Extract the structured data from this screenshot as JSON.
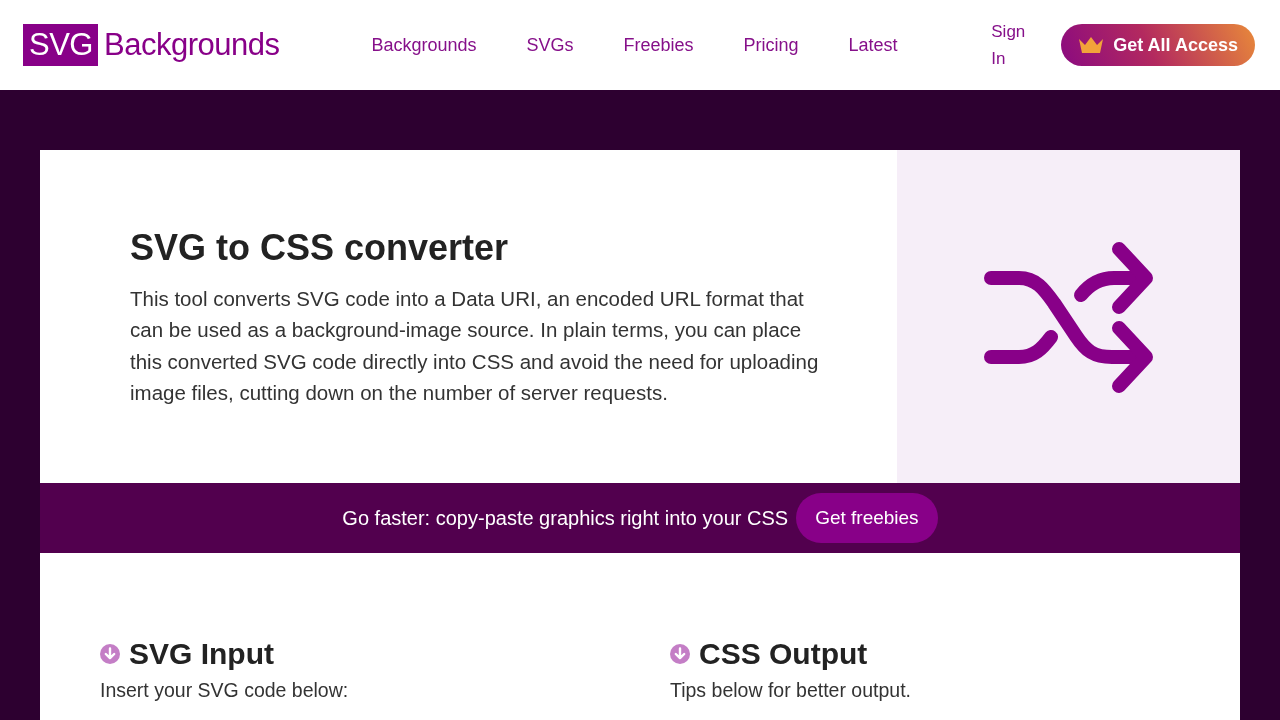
{
  "header": {
    "logo": {
      "badge": "SVG",
      "text": "Backgrounds"
    },
    "nav": [
      "Backgrounds",
      "SVGs",
      "Freebies",
      "Pricing",
      "Latest"
    ],
    "sign_in": "Sign In",
    "cta": "Get All Access"
  },
  "hero": {
    "title": "SVG to CSS converter",
    "description": "This tool converts SVG code into a Data URI, an encoded URL format that can be used as a background-image source. In plain terms, you can place this converted SVG code directly into CSS and avoid the need for uploading image files, cutting down on the number of server requests."
  },
  "banner": {
    "text": "Go faster: copy-paste graphics right into your CSS",
    "button": "Get freebies"
  },
  "sections": [
    {
      "title": "SVG Input",
      "subtitle": "Insert your SVG code below:"
    },
    {
      "title": "CSS Output",
      "subtitle": "Tips below for better output."
    }
  ]
}
